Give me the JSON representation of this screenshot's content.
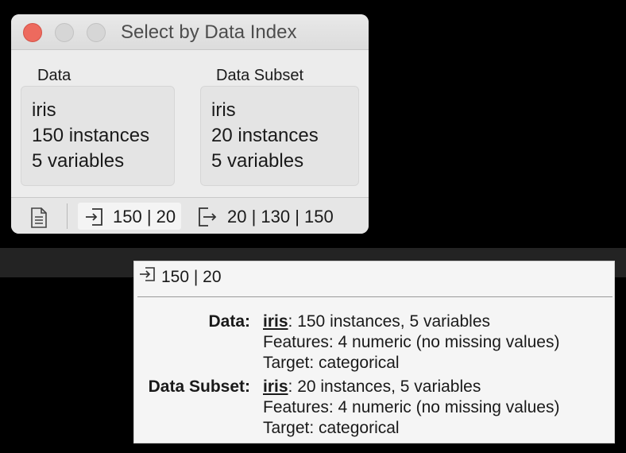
{
  "window": {
    "title": "Select by Data Index",
    "data_group": {
      "label": "Data",
      "name": "iris",
      "instances": "150 instances",
      "variables": "5 variables"
    },
    "subset_group": {
      "label": "Data Subset",
      "name": "iris",
      "instances": "20 instances",
      "variables": "5 variables"
    },
    "status": {
      "input_summary": "150 | 20",
      "output_summary": "20 | 130 | 150"
    }
  },
  "tooltip": {
    "header": "150 | 20",
    "sections": [
      {
        "label": "Data:",
        "name": "iris",
        "summary": ": 150 instances, 5 variables",
        "features": "Features: 4 numeric (no missing values)",
        "target": "Target: categorical"
      },
      {
        "label": "Data Subset:",
        "name": "iris",
        "summary": ": 20 instances, 5 variables",
        "features": "Features: 4 numeric (no missing values)",
        "target": "Target: categorical"
      }
    ]
  },
  "colors": {
    "close": "#ed6a5e",
    "window_bg": "#ececec",
    "tooltip_bg": "#f5f5f5"
  }
}
